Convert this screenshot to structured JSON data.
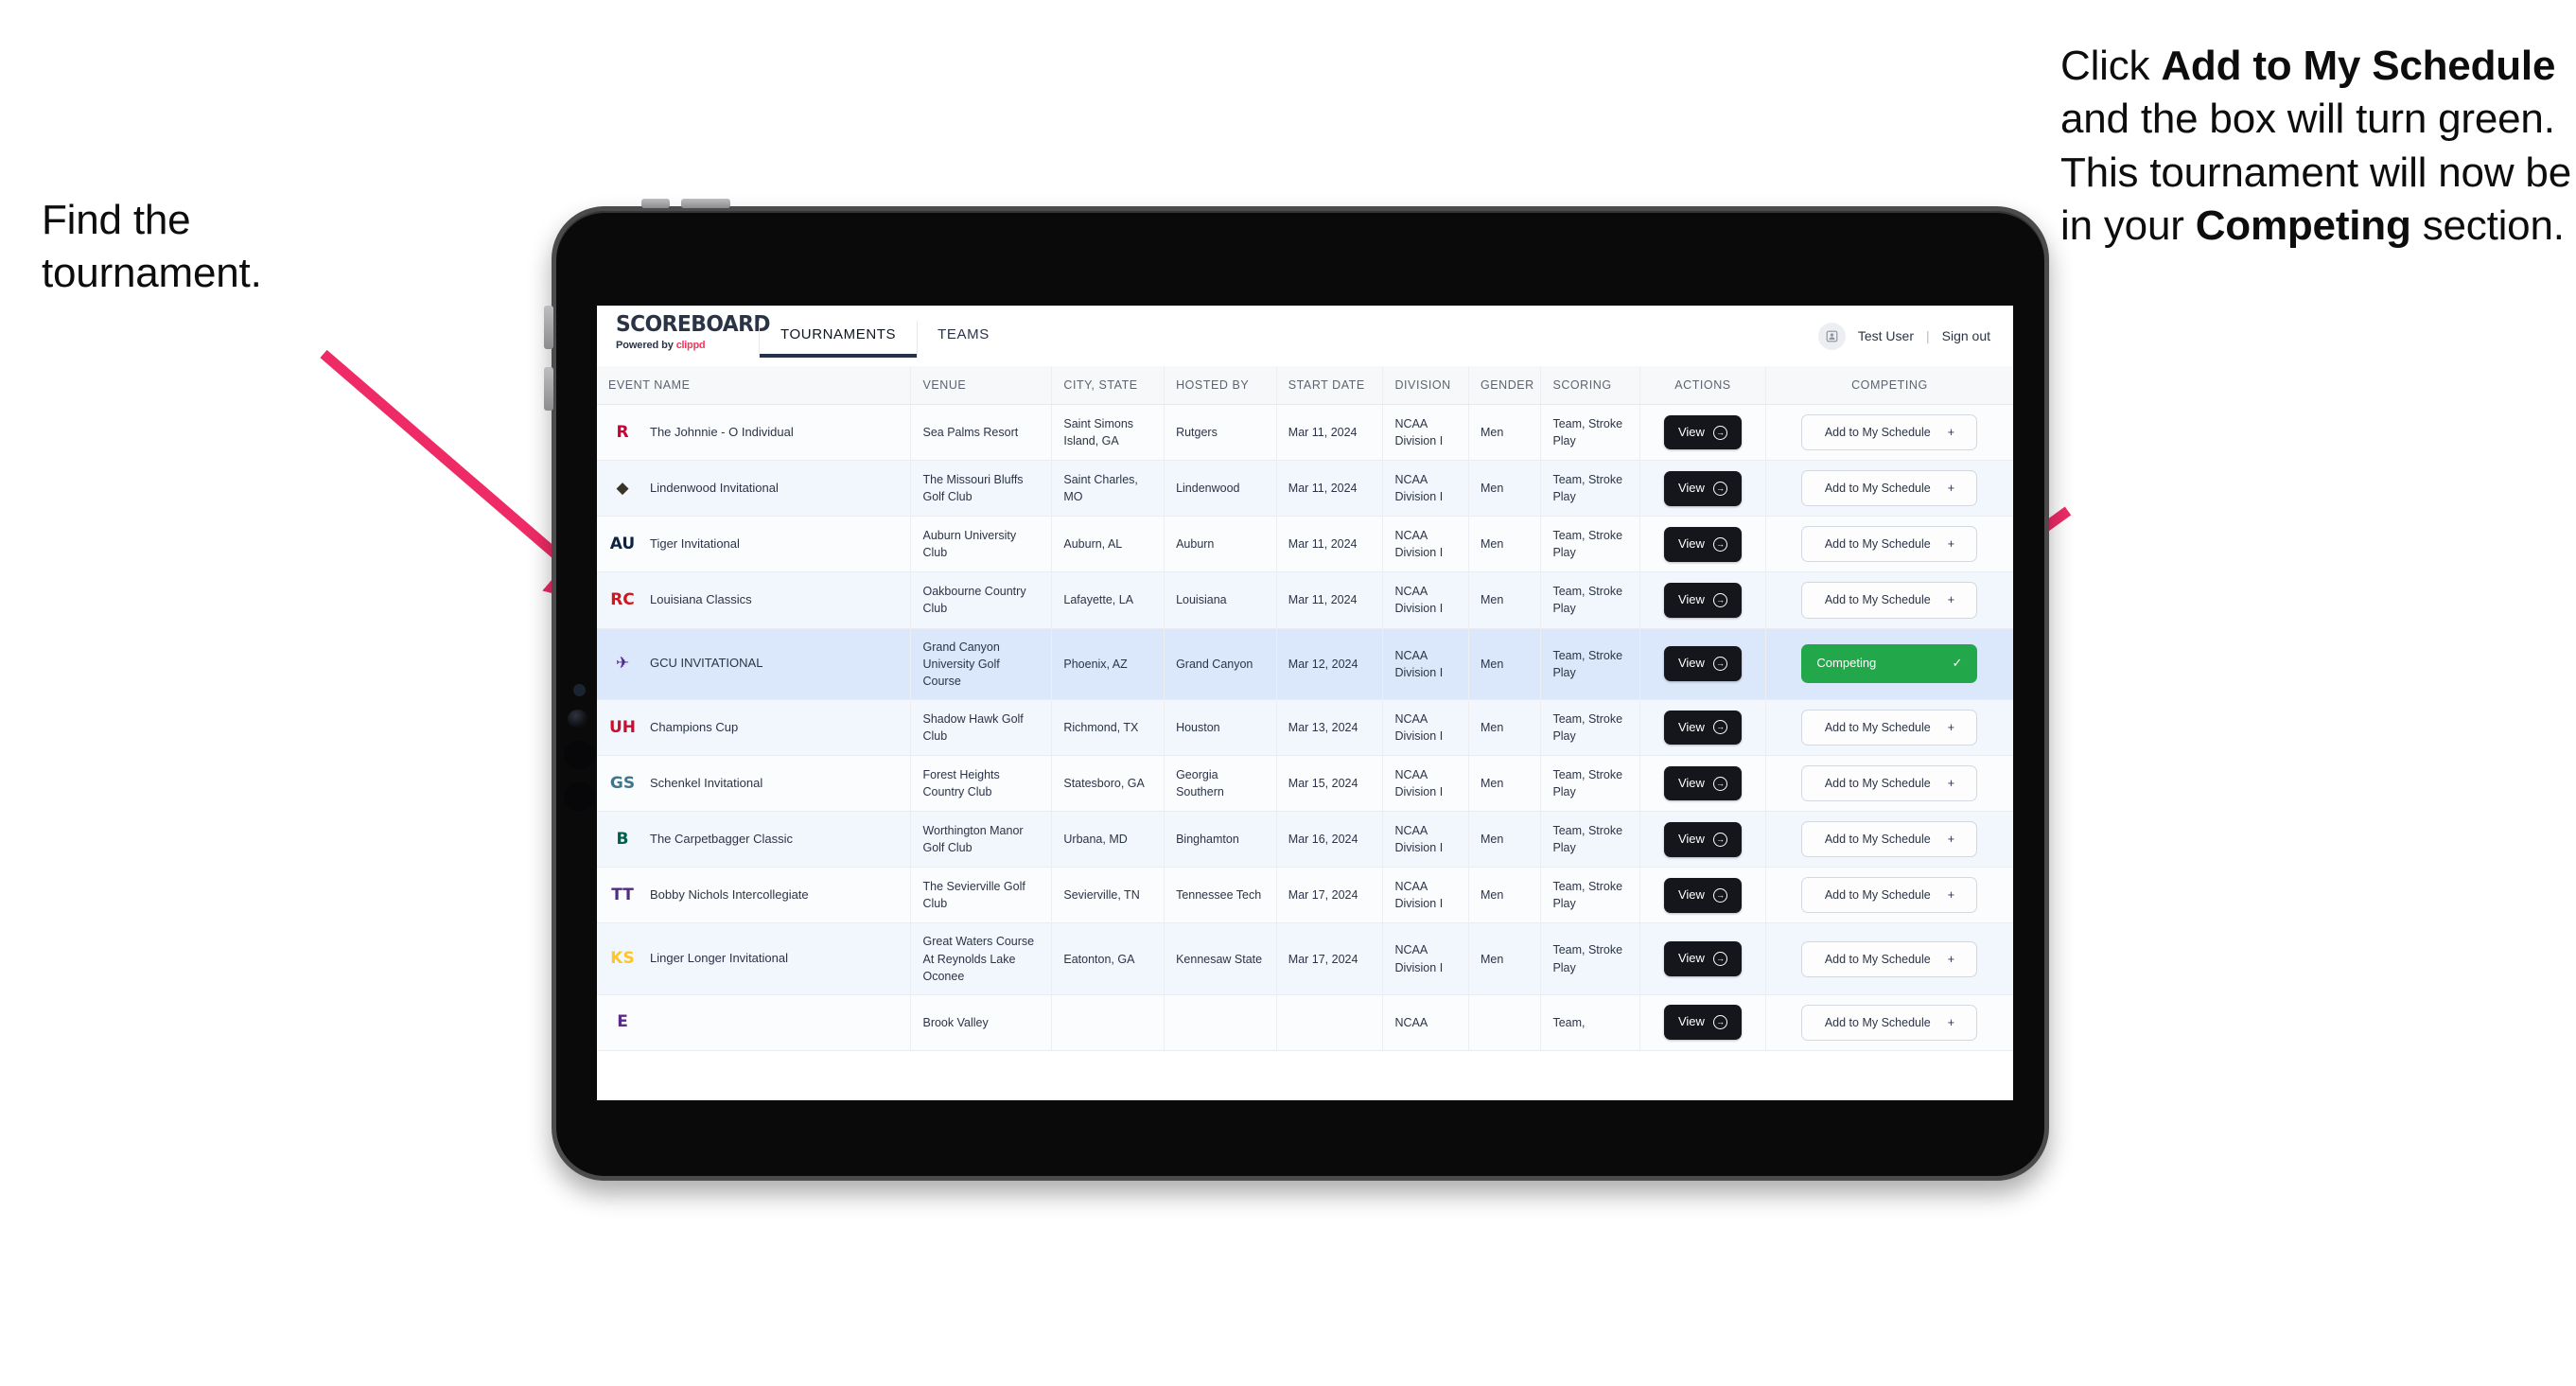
{
  "annotations": {
    "left": {
      "line1": "Find the",
      "line2": "tournament."
    },
    "right": {
      "seg1": "Click ",
      "bold1": "Add to My Schedule",
      "seg2": " and the box will turn green. This tournament will now be in your ",
      "bold2": "Competing",
      "seg3": " section."
    },
    "arrow_color": "#EE2B66"
  },
  "app": {
    "brand": {
      "title": "SCOREBOARD",
      "powered_prefix": "Powered by ",
      "powered_brand": "clippd"
    },
    "nav": {
      "tabs": [
        {
          "label": "TOURNAMENTS",
          "active": true
        },
        {
          "label": "TEAMS",
          "active": false
        }
      ]
    },
    "header_right": {
      "avatar_icon": "user-avatar-icon",
      "user_name": "Test User",
      "separator": "|",
      "sign_out": "Sign out"
    }
  },
  "table": {
    "columns": [
      "EVENT NAME",
      "VENUE",
      "CITY, STATE",
      "HOSTED BY",
      "START DATE",
      "DIVISION",
      "GENDER",
      "SCORING",
      "ACTIONS",
      "COMPETING"
    ],
    "action_label": "View",
    "add_label": "Add to My Schedule",
    "add_icon": "plus-icon",
    "competing_label": "Competing",
    "competing_icon": "check-icon",
    "rows": [
      {
        "logo": "rutgers-logo",
        "logo_text": "R",
        "logo_color": "#CC0033",
        "event": "The Johnnie - O Individual",
        "venue": "Sea Palms Resort",
        "city": "Saint Simons Island, GA",
        "host": "Rutgers",
        "date": "Mar 11, 2024",
        "division": "NCAA Division I",
        "gender": "Men",
        "scoring": "Team, Stroke Play",
        "competing": false
      },
      {
        "logo": "lindenwood-logo",
        "logo_text": "◆",
        "logo_color": "#3A3327",
        "event": "Lindenwood Invitational",
        "venue": "The Missouri Bluffs Golf Club",
        "city": "Saint Charles, MO",
        "host": "Lindenwood",
        "date": "Mar 11, 2024",
        "division": "NCAA Division I",
        "gender": "Men",
        "scoring": "Team, Stroke Play",
        "competing": false
      },
      {
        "logo": "auburn-logo",
        "logo_text": "AU",
        "logo_color": "#0C2340",
        "event": "Tiger Invitational",
        "venue": "Auburn University Club",
        "city": "Auburn, AL",
        "host": "Auburn",
        "date": "Mar 11, 2024",
        "division": "NCAA Division I",
        "gender": "Men",
        "scoring": "Team, Stroke Play",
        "competing": false
      },
      {
        "logo": "louisiana-logo",
        "logo_text": "RC",
        "logo_color": "#CE181E",
        "event": "Louisiana Classics",
        "venue": "Oakbourne Country Club",
        "city": "Lafayette, LA",
        "host": "Louisiana",
        "date": "Mar 11, 2024",
        "division": "NCAA Division I",
        "gender": "Men",
        "scoring": "Team, Stroke Play",
        "competing": false
      },
      {
        "logo": "gcu-logo",
        "logo_text": "✈",
        "logo_color": "#522398",
        "event": "GCU INVITATIONAL",
        "venue": "Grand Canyon University Golf Course",
        "city": "Phoenix, AZ",
        "host": "Grand Canyon",
        "date": "Mar 12, 2024",
        "division": "NCAA Division I",
        "gender": "Men",
        "scoring": "Team, Stroke Play",
        "competing": true,
        "selected": true
      },
      {
        "logo": "houston-logo",
        "logo_text": "UH",
        "logo_color": "#C8102E",
        "event": "Champions Cup",
        "venue": "Shadow Hawk Golf Club",
        "city": "Richmond, TX",
        "host": "Houston",
        "date": "Mar 13, 2024",
        "division": "NCAA Division I",
        "gender": "Men",
        "scoring": "Team, Stroke Play",
        "competing": false
      },
      {
        "logo": "georgia-southern-logo",
        "logo_text": "GS",
        "logo_color": "#41748D",
        "event": "Schenkel Invitational",
        "venue": "Forest Heights Country Club",
        "city": "Statesboro, GA",
        "host": "Georgia Southern",
        "date": "Mar 15, 2024",
        "division": "NCAA Division I",
        "gender": "Men",
        "scoring": "Team, Stroke Play",
        "competing": false
      },
      {
        "logo": "binghamton-logo",
        "logo_text": "B",
        "logo_color": "#00604B",
        "event": "The Carpetbagger Classic",
        "venue": "Worthington Manor Golf Club",
        "city": "Urbana, MD",
        "host": "Binghamton",
        "date": "Mar 16, 2024",
        "division": "NCAA Division I",
        "gender": "Men",
        "scoring": "Team, Stroke Play",
        "competing": false
      },
      {
        "logo": "tennessee-tech-logo",
        "logo_text": "TT",
        "logo_color": "#502D7F",
        "event": "Bobby Nichols Intercollegiate",
        "venue": "The Sevierville Golf Club",
        "city": "Sevierville, TN",
        "host": "Tennessee Tech",
        "date": "Mar 17, 2024",
        "division": "NCAA Division I",
        "gender": "Men",
        "scoring": "Team, Stroke Play",
        "competing": false
      },
      {
        "logo": "kennesaw-state-logo",
        "logo_text": "KS",
        "logo_color": "#FFC629",
        "event": "Linger Longer Invitational",
        "venue": "Great Waters Course At Reynolds Lake Oconee",
        "city": "Eatonton, GA",
        "host": "Kennesaw State",
        "date": "Mar 17, 2024",
        "division": "NCAA Division I",
        "gender": "Men",
        "scoring": "Team, Stroke Play",
        "competing": false
      },
      {
        "logo": "ecu-logo",
        "logo_text": "E",
        "logo_color": "#592A8A",
        "event": "",
        "venue": "Brook Valley",
        "city": "",
        "host": "",
        "date": "",
        "division": "NCAA",
        "gender": "",
        "scoring": "Team,",
        "competing": false,
        "clipped": true
      }
    ]
  }
}
